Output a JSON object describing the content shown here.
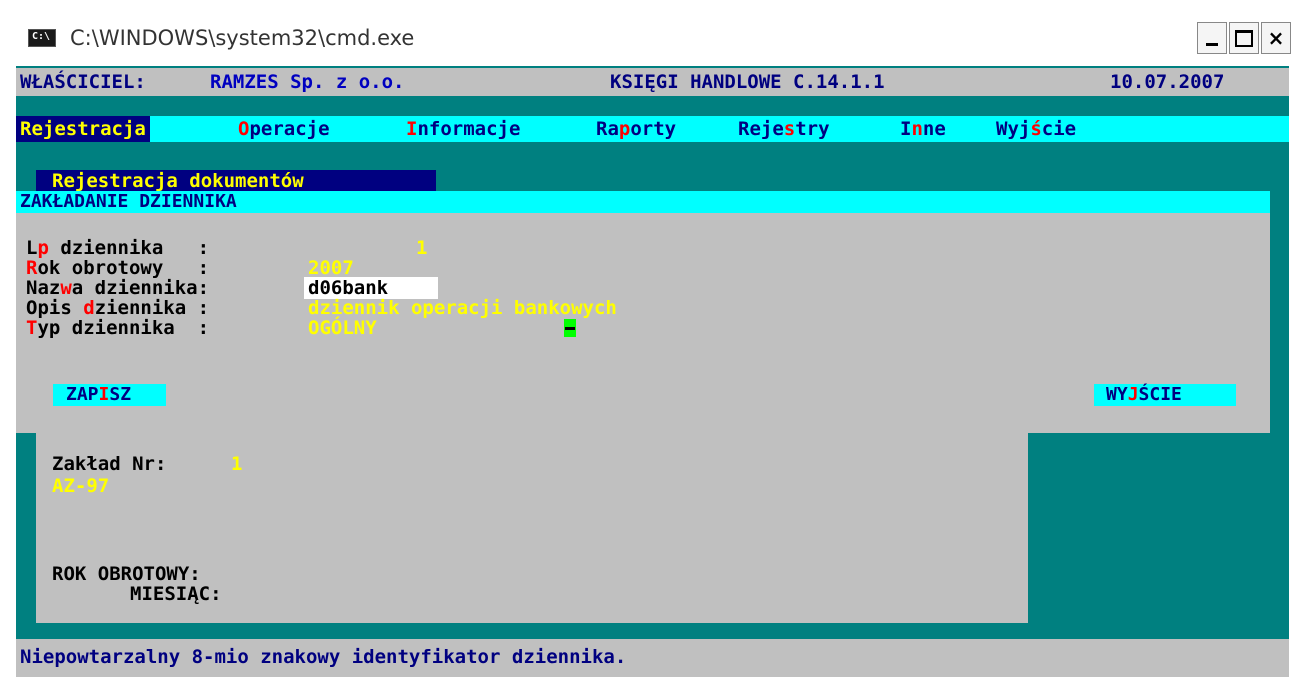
{
  "window": {
    "title": "C:\\WINDOWS\\system32\\cmd.exe",
    "icon_text": "C:\\",
    "minimize_label": "_",
    "close_label": "×"
  },
  "header": {
    "owner_label": "WŁAŚCICIEL:",
    "owner_name": "RAMZES Sp. z o.o.",
    "app_name": "KSIĘGI HANDLOWE C.14.1.1",
    "date": "10.07.2007"
  },
  "menu": {
    "items": [
      {
        "label": "Rejestracja",
        "hot": "R",
        "selected": true
      },
      {
        "label": "Operacje",
        "hot": "O",
        "selected": false
      },
      {
        "label": "Informacje",
        "hot": "I",
        "selected": false
      },
      {
        "label": "Raporty",
        "hot": "p",
        "selected": false
      },
      {
        "label": "Rejestry",
        "hot": "s",
        "selected": false
      },
      {
        "label": "Inne",
        "hot": "n",
        "selected": false
      },
      {
        "label": "Wyjście",
        "hot": "ś",
        "selected": false
      }
    ]
  },
  "dialog": {
    "window_label": "Rejestracja dokumentów",
    "title": "ZAKŁADANIE DZIENNIKA",
    "fields": [
      {
        "label_pre": "L",
        "hot": "p",
        "label_post": " dziennika   :",
        "value": "1"
      },
      {
        "label_pre": "",
        "hot": "R",
        "label_post": "ok obrotowy   :",
        "value": "2007"
      },
      {
        "label_pre": "Naz",
        "hot": "w",
        "label_post": "a dziennika:",
        "value": "d06bank"
      },
      {
        "label_pre": "Opis ",
        "hot": "d",
        "label_post": "ziennika :",
        "value": "dziennik operacji bankowych"
      },
      {
        "label_pre": "",
        "hot": "T",
        "label_post": "yp dziennika  :",
        "value": "OGÓLNY"
      }
    ],
    "save_button": {
      "pre": "ZAP",
      "hot": "I",
      "post": "SZ"
    },
    "exit_button": {
      "pre": "WY",
      "hot": "J",
      "post": "ŚCIE"
    }
  },
  "info": {
    "plant_label": "Zakład Nr:",
    "plant_number": "1",
    "plant_code": "AZ-97",
    "fiscal_year_label": "ROK OBROTOWY:",
    "month_label": "MIESIĄC:"
  },
  "status": {
    "hint": "Niepowtarzalny 8-mio znakowy identyfikator dziennika."
  },
  "colors": {
    "console_bg": "#008080",
    "panel_gray": "#c0c0c0",
    "cyan": "#00ffff",
    "navy": "#000080",
    "yellow": "#ffff00",
    "hotkey_red": "#ff0000",
    "cursor_green": "#00ff00"
  }
}
